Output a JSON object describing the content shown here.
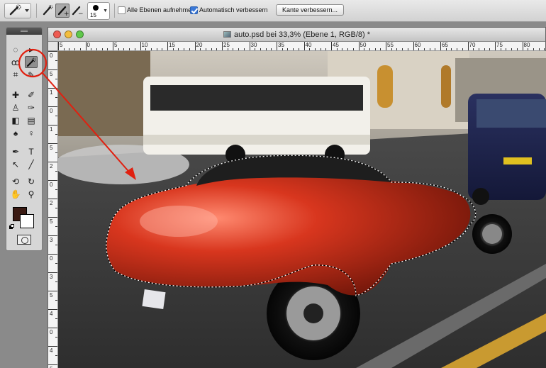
{
  "options_bar": {
    "all_layers_label": "Alle Ebenen aufnehmen",
    "all_layers_checked": false,
    "auto_enhance_label": "Automatisch verbessern",
    "auto_enhance_checked": true,
    "refine_edge_label": "Kante verbessern...",
    "brush_size": "15"
  },
  "tools_panel": {
    "active_tool": "quick-selection-tool",
    "foreground_color": "#3a1a12",
    "background_color": "#ffffff"
  },
  "document": {
    "title": "auto.psd bei 33,3% (Ebene 1, RGB/8) *",
    "ruler_top_labels": [
      "5",
      "0",
      "5",
      "10",
      "15",
      "20",
      "25",
      "30",
      "35",
      "40",
      "45",
      "50",
      "55",
      "60",
      "65",
      "70",
      "75",
      "80"
    ],
    "ruler_left_labels": [
      "0",
      "5",
      "1",
      "0",
      "1",
      "5",
      "2",
      "0",
      "2",
      "5",
      "3",
      "0",
      "3",
      "5",
      "4",
      "0",
      "4",
      "5"
    ]
  },
  "annotation": {
    "color": "#e02010"
  }
}
